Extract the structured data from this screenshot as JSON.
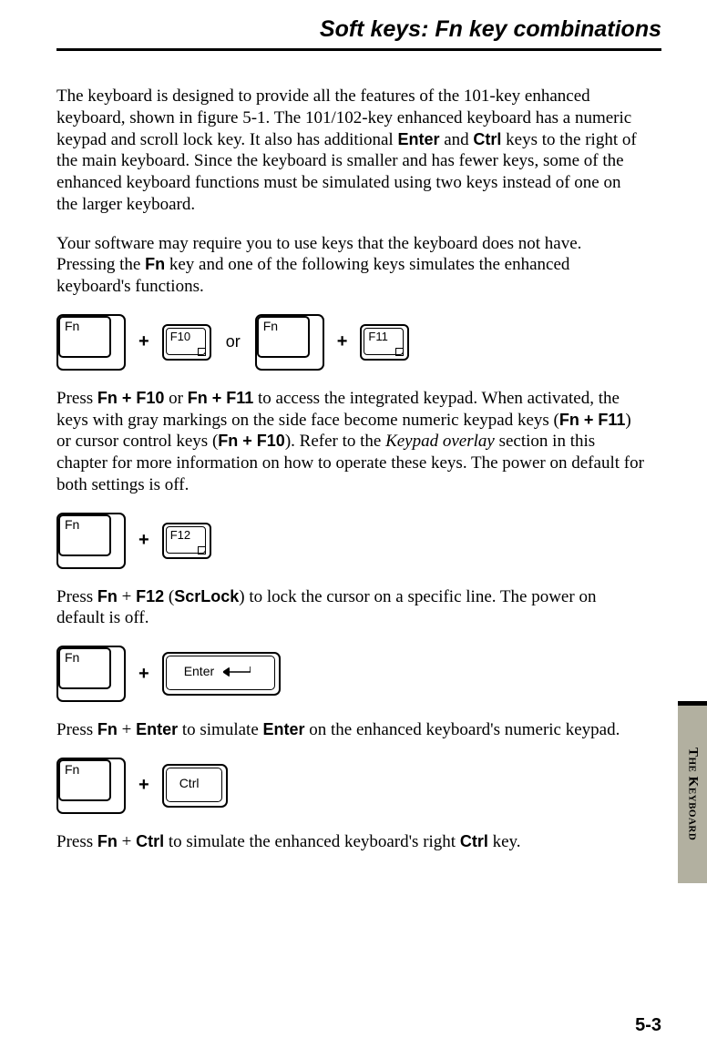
{
  "header": {
    "title": "Soft keys: Fn key combinations"
  },
  "intro": {
    "p1_a": "The keyboard is designed to provide all the features of the 101-key enhanced keyboard, shown in figure 5-1. The 101/102-key enhanced keyboard has a numeric keypad and scroll lock key. It also has additional ",
    "p1_b": "Enter",
    "p1_c": " and ",
    "p1_d": "Ctrl",
    "p1_e": " keys to the right of the main keyboard. Since the keyboard is smaller and has fewer keys, some of the enhanced keyboard functions must be simulated using two keys instead of one on the larger keyboard.",
    "p2_a": "Your software may require you to use keys that the keyboard does not have. Pressing the ",
    "p2_b": "Fn",
    "p2_c": " key and one of the following keys simulates the enhanced keyboard's functions."
  },
  "keys": {
    "fn": "Fn",
    "f10": "F10",
    "f11": "F11",
    "f12": "F12",
    "enter": "Enter",
    "ctrl": "Ctrl",
    "plus": "+",
    "or": "or"
  },
  "sections": {
    "s1_a": "Press ",
    "s1_b": "Fn + F10",
    "s1_c": " or ",
    "s1_d": "Fn + F11",
    "s1_e": " to access the integrated keypad. When activated, the keys with gray markings on the side face become numeric keypad keys (",
    "s1_f": "Fn + F11",
    "s1_g": ") or cursor control keys (",
    "s1_h": "Fn + F10",
    "s1_i": "). Refer to the ",
    "s1_j": "Keypad overlay",
    "s1_k": " section in this chapter for more information on how to operate these keys. The power on default for both settings is off.",
    "s2_a": "Press ",
    "s2_b": "Fn",
    "s2_c": " + ",
    "s2_d": "F12",
    "s2_e": " (",
    "s2_f": "ScrLock",
    "s2_g": ") to lock the cursor on a specific line. The power on default is off.",
    "s3_a": "Press ",
    "s3_b": "Fn",
    "s3_c": " + ",
    "s3_d": "Enter",
    "s3_e": " to simulate ",
    "s3_f": "Enter",
    "s3_g": " on the enhanced keyboard's numeric keypad.",
    "s4_a": "Press ",
    "s4_b": "Fn",
    "s4_c": " + ",
    "s4_d": "Ctrl",
    "s4_e": " to simulate the enhanced keyboard's right ",
    "s4_f": "Ctrl",
    "s4_g": " key."
  },
  "sidebar": {
    "label": "The Keyboard"
  },
  "footer": {
    "page": "5-3"
  }
}
